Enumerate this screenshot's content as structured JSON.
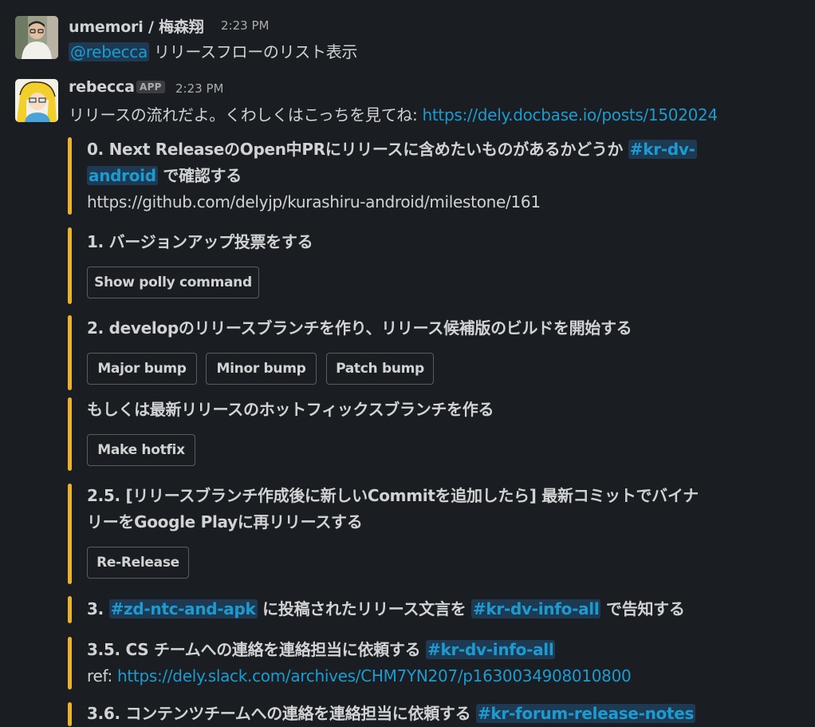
{
  "messages": [
    {
      "author": "umemori / 梅森翔",
      "time": "2:23 PM",
      "mention": "@rebecca",
      "text": " リリースフローのリスト表示"
    },
    {
      "author": "rebecca",
      "badge": "APP",
      "time": "2:23 PM",
      "text": "リリースの流れだよ。くわしくはこっちを見てね: ",
      "link": "https://dely.docbase.io/posts/1502024"
    }
  ],
  "steps": {
    "s0": {
      "line1": "0. Next ReleaseのOpen中PRにリリースに含めたいものがあるかどうか ",
      "chan_a": "#kr-dv-",
      "chan_b": "android",
      "line2_rest": " で確認する",
      "url": "https://github.com/delyjp/kurashiru-android/milestone/161"
    },
    "s1": {
      "title": "1. バージョンアップ投票をする",
      "button": "Show polly command"
    },
    "s2": {
      "title": "2. developのリリースブランチを作り、リリース候補版のビルドを開始する",
      "buttons": [
        "Major bump",
        "Minor bump",
        "Patch bump"
      ]
    },
    "s2b": {
      "title": "もしくは最新リリースのホットフィックスブランチを作る",
      "button": "Make hotfix"
    },
    "s25": {
      "line1": "2.5. [リリースブランチ作成後に新しいCommitを追加したら] 最新コミットでバイナ",
      "line2": "リーをGoogle Playに再リリースする",
      "button": "Re-Release"
    },
    "s3": {
      "prefix": "3. ",
      "chan1": "#zd-ntc-and-apk",
      "mid": " に投稿されたリリース文言を ",
      "chan2": "#kr-dv-info-all",
      "suffix": " で告知する"
    },
    "s35": {
      "title": "3.5. CS チームへの連絡を連絡担当に依頼する ",
      "chan": "#kr-dv-info-all",
      "ref_label": "ref: ",
      "ref_url": "https://dely.slack.com/archives/CHM7YN207/p1630034908010800"
    },
    "s36": {
      "title": "3.6. コンテンツチームへの連絡を連絡担当に依頼する ",
      "chan": "#kr-forum-release-notes"
    }
  },
  "colors": {
    "accent_bar": "#ecb22e",
    "link": "#1d9bd1",
    "background": "#1a1d21"
  }
}
